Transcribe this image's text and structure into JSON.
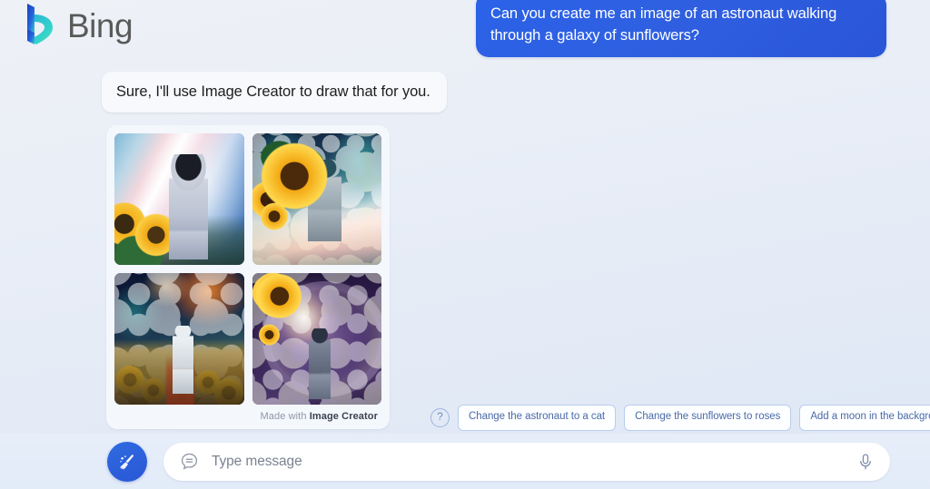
{
  "brand": {
    "name": "Bing",
    "logo_icon": "bing-b-logo",
    "logo_gradient_from": "#1b4fd8",
    "logo_gradient_to": "#37d7c8"
  },
  "conversation": {
    "user_message": "Can you create me an image of an astronaut walking through a galaxy of sunflowers?",
    "user_bubble_color": "#2b5fe3",
    "assistant_message": "Sure, I'll use Image Creator to draw that for you."
  },
  "image_results": {
    "attribution_prefix": "Made with",
    "attribution_brand": "Image Creator",
    "thumbnails": [
      {
        "alt": "Astronaut in white spacesuit facing forward amid sunflowers under a pink and white nebula streak"
      },
      {
        "alt": "Astronaut walking away through golden mist with large sunflowers and a teal pink galaxy sky"
      },
      {
        "alt": "Astronaut seen from behind walking a path through a field of sunflowers under an orange cosmic burst"
      },
      {
        "alt": "Astronaut silhouetted before a glowing galaxy portal ringed by sunflowers"
      }
    ]
  },
  "suggestions": {
    "help_icon": "question-mark-icon",
    "chips": [
      "Change the astronaut to a cat",
      "Change the sunflowers to roses",
      "Add a moon in the background"
    ]
  },
  "composer": {
    "sweep_icon": "broom-sparkle-icon",
    "message_icon": "chat-bubble-icon",
    "placeholder": "Type message",
    "value": "",
    "mic_icon": "microphone-icon"
  }
}
